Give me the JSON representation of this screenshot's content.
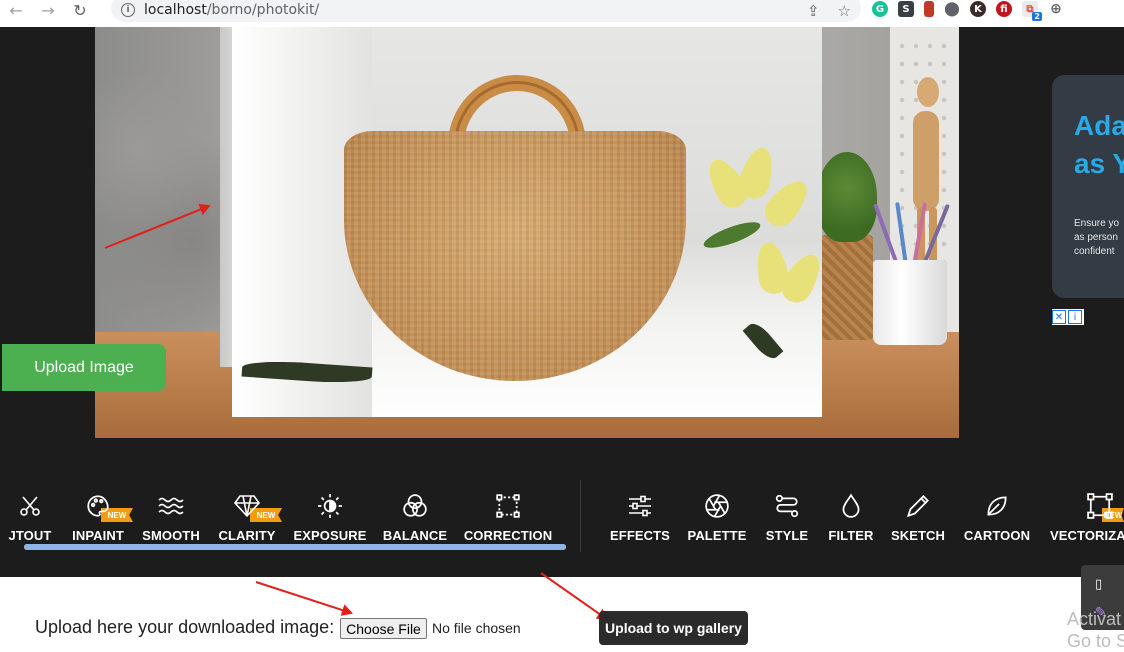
{
  "browser": {
    "url_host": "localhost",
    "url_path": "/borno/photokit/",
    "extension_badge": "2"
  },
  "editor": {
    "upload_image_label": "Upload Image"
  },
  "ad": {
    "title": "Ada\nas Y",
    "text": "Ensure yo\nas person\nconfident"
  },
  "toolbar": {
    "tools": [
      {
        "label": "JTOUT",
        "icon": "scissors-icon",
        "new": false
      },
      {
        "label": "INPAINT",
        "icon": "palette-icon",
        "new": true
      },
      {
        "label": "SMOOTH",
        "icon": "waves-icon",
        "new": false
      },
      {
        "label": "CLARITY",
        "icon": "diamond-icon",
        "new": true
      },
      {
        "label": "EXPOSURE",
        "icon": "sun-icon",
        "new": false
      },
      {
        "label": "BALANCE",
        "icon": "color-circles-icon",
        "new": false
      },
      {
        "label": "CORRECTION",
        "icon": "crop-icon",
        "new": false
      },
      {
        "label": "EFFECTS",
        "icon": "sliders-icon",
        "new": false
      },
      {
        "label": "PALETTE",
        "icon": "aperture-icon",
        "new": false
      },
      {
        "label": "STYLE",
        "icon": "style-icon",
        "new": false
      },
      {
        "label": "FILTER",
        "icon": "drop-icon",
        "new": false
      },
      {
        "label": "SKETCH",
        "icon": "pencil-icon",
        "new": false
      },
      {
        "label": "CARTOON",
        "icon": "leaf-icon",
        "new": false
      },
      {
        "label": "VECTORIZAT",
        "icon": "vector-icon",
        "new": true
      }
    ],
    "new_badge": "NEW",
    "scroll_progress": 0.5
  },
  "bottom": {
    "upload_label": "Upload here your downloaded image:",
    "choose_file_label": "Choose File",
    "no_file_text": "No file chosen",
    "wp_gallery_label": "Upload to wp gallery",
    "watermark_text": "Activat\nGo to Se"
  },
  "colors": {
    "upload_button": "#4caf50",
    "new_badge": "#f39c12",
    "annotation_arrow": "#e0201b",
    "ad_title": "#29a9e8"
  }
}
